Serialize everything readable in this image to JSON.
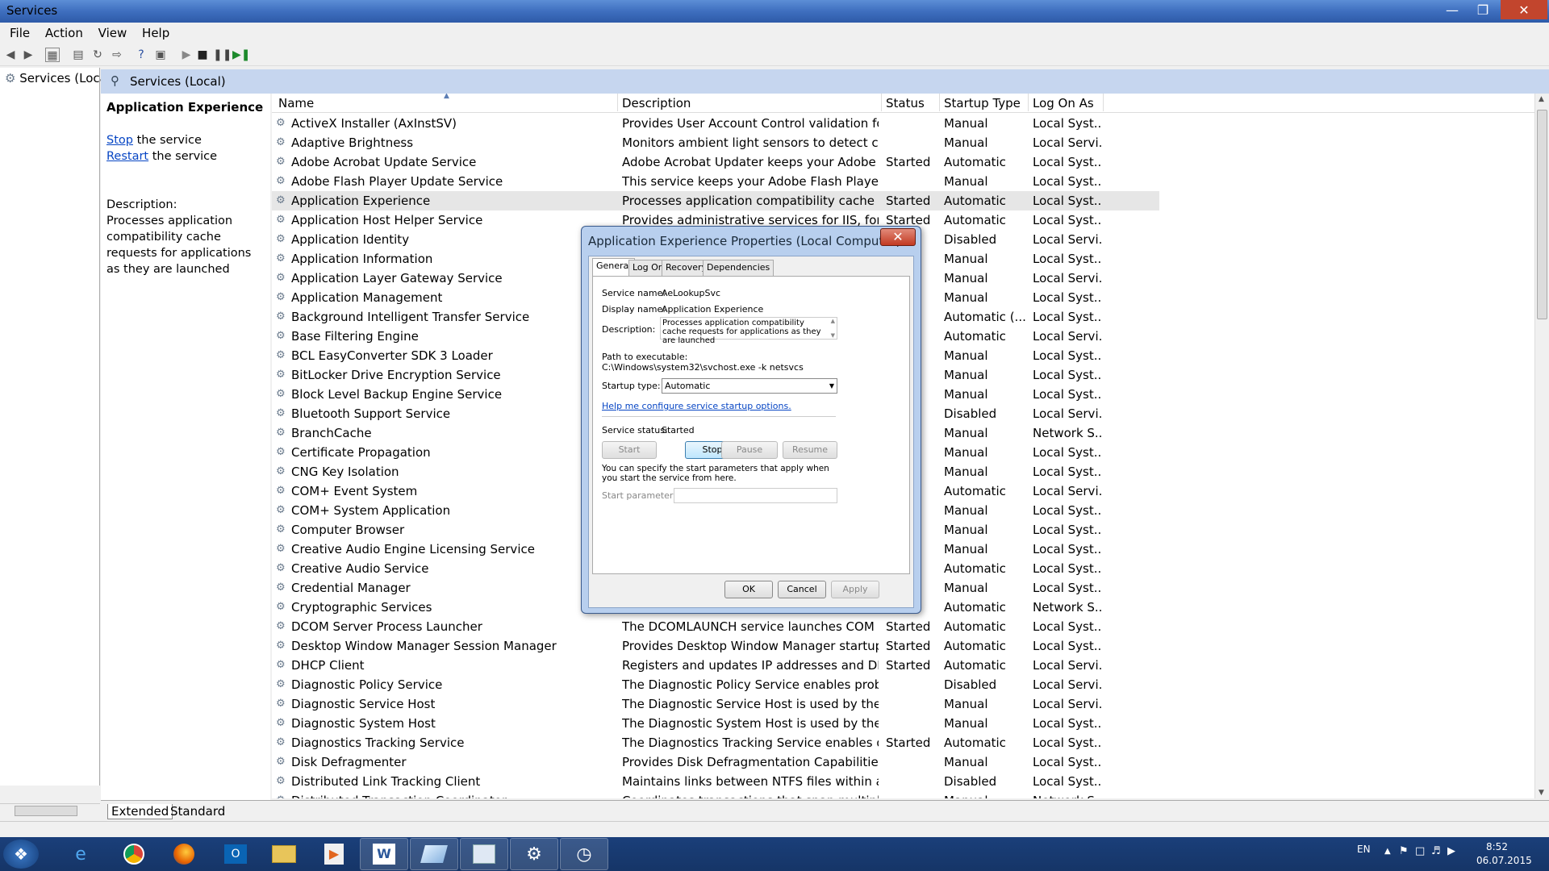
{
  "window": {
    "title": "Services"
  },
  "menu": [
    "File",
    "Action",
    "View",
    "Help"
  ],
  "tree": {
    "item": "Services (Loca"
  },
  "header": {
    "title": "Services (Local)"
  },
  "info": {
    "title": "Application Experience",
    "stop_link": "Stop",
    "stop_rest": " the service",
    "restart_link": "Restart",
    "restart_rest": " the service",
    "desc_label": "Description:",
    "desc_text": "Processes application compatibility cache requests for applications as they are launched"
  },
  "columns": [
    "Name",
    "Description",
    "Status",
    "Startup Type",
    "Log On As"
  ],
  "services": [
    [
      "ActiveX Installer (AxInstSV)",
      "Provides User Account Control validation for t...",
      "",
      "Manual",
      "Local Syst..."
    ],
    [
      "Adaptive Brightness",
      "Monitors ambient light sensors to detect chan...",
      "",
      "Manual",
      "Local Servi..."
    ],
    [
      "Adobe Acrobat Update Service",
      "Adobe Acrobat Updater keeps your Adobe so...",
      "Started",
      "Automatic",
      "Local Syst..."
    ],
    [
      "Adobe Flash Player Update Service",
      "This service keeps your Adobe Flash Player ins...",
      "",
      "Manual",
      "Local Syst..."
    ],
    [
      "Application Experience",
      "Processes application compatibility cache req...",
      "Started",
      "Automatic",
      "Local Syst..."
    ],
    [
      "Application Host Helper Service",
      "Provides administrative services for IIS, for exa...",
      "Started",
      "Automatic",
      "Local Syst..."
    ],
    [
      "Application Identity",
      "",
      "",
      "Disabled",
      "Local Servi..."
    ],
    [
      "Application Information",
      "",
      "",
      "Manual",
      "Local Syst..."
    ],
    [
      "Application Layer Gateway Service",
      "",
      "",
      "Manual",
      "Local Servi..."
    ],
    [
      "Application Management",
      "",
      "",
      "Manual",
      "Local Syst..."
    ],
    [
      "Background Intelligent Transfer Service",
      "",
      "",
      "Automatic (...",
      "Local Syst..."
    ],
    [
      "Base Filtering Engine",
      "",
      "",
      "Automatic",
      "Local Servi..."
    ],
    [
      "BCL EasyConverter SDK 3 Loader",
      "",
      "",
      "Manual",
      "Local Syst..."
    ],
    [
      "BitLocker Drive Encryption Service",
      "",
      "",
      "Manual",
      "Local Syst..."
    ],
    [
      "Block Level Backup Engine Service",
      "",
      "",
      "Manual",
      "Local Syst..."
    ],
    [
      "Bluetooth Support Service",
      "",
      "",
      "Disabled",
      "Local Servi..."
    ],
    [
      "BranchCache",
      "",
      "",
      "Manual",
      "Network S..."
    ],
    [
      "Certificate Propagation",
      "",
      "",
      "Manual",
      "Local Syst..."
    ],
    [
      "CNG Key Isolation",
      "",
      "",
      "Manual",
      "Local Syst..."
    ],
    [
      "COM+ Event System",
      "",
      "",
      "Automatic",
      "Local Servi..."
    ],
    [
      "COM+ System Application",
      "",
      "",
      "Manual",
      "Local Syst..."
    ],
    [
      "Computer Browser",
      "",
      "",
      "Manual",
      "Local Syst..."
    ],
    [
      "Creative Audio Engine Licensing Service",
      "",
      "",
      "Manual",
      "Local Syst..."
    ],
    [
      "Creative Audio Service",
      "",
      "",
      "Automatic",
      "Local Syst..."
    ],
    [
      "Credential Manager",
      "",
      "",
      "Manual",
      "Local Syst..."
    ],
    [
      "Cryptographic Services",
      "",
      "",
      "Automatic",
      "Network S..."
    ],
    [
      "DCOM Server Process Launcher",
      "The DCOMLAUNCH service launches COM and...",
      "Started",
      "Automatic",
      "Local Syst..."
    ],
    [
      "Desktop Window Manager Session Manager",
      "Provides Desktop Window Manager startup a...",
      "Started",
      "Automatic",
      "Local Syst..."
    ],
    [
      "DHCP Client",
      "Registers and updates IP addresses and DNS r...",
      "Started",
      "Automatic",
      "Local Servi..."
    ],
    [
      "Diagnostic Policy Service",
      "The Diagnostic Policy Service enables proble...",
      "",
      "Disabled",
      "Local Servi..."
    ],
    [
      "Diagnostic Service Host",
      "The Diagnostic Service Host is used by the Dia...",
      "",
      "Manual",
      "Local Servi..."
    ],
    [
      "Diagnostic System Host",
      "The Diagnostic System Host is used by the Dia...",
      "",
      "Manual",
      "Local Syst..."
    ],
    [
      "Diagnostics Tracking Service",
      "The Diagnostics Tracking Service enables data...",
      "Started",
      "Automatic",
      "Local Syst..."
    ],
    [
      "Disk Defragmenter",
      "Provides Disk Defragmentation Capabilities.",
      "",
      "Manual",
      "Local Syst..."
    ],
    [
      "Distributed Link Tracking Client",
      "Maintains links between NTFS files within a co...",
      "",
      "Disabled",
      "Local Syst..."
    ],
    [
      "Distributed Transaction Coordinator",
      "Coordinates transactions that span multiple re...",
      "",
      "Manual",
      "Network S..."
    ]
  ],
  "tabs": [
    "Extended",
    "Standard"
  ],
  "dialog": {
    "title": "Application Experience Properties (Local Computer)",
    "tabs": [
      "General",
      "Log On",
      "Recovery",
      "Dependencies"
    ],
    "service_name_label": "Service name:",
    "service_name": "AeLookupSvc",
    "display_name_label": "Display name:",
    "display_name": "Application Experience",
    "description_label": "Description:",
    "description": "Processes application compatibility cache requests for applications as they are launched",
    "path_label": "Path to executable:",
    "path": "C:\\Windows\\system32\\svchost.exe -k netsvcs",
    "startup_label": "Startup type:",
    "startup_value": "Automatic",
    "help_link": "Help me configure service startup options.",
    "status_label": "Service status:",
    "status_value": "Started",
    "buttons": {
      "start": "Start",
      "stop": "Stop",
      "pause": "Pause",
      "resume": "Resume"
    },
    "params_note": "You can specify the start parameters that apply when you start the service from here.",
    "params_label": "Start parameters:",
    "ok": "OK",
    "cancel": "Cancel",
    "apply": "Apply"
  },
  "tray": {
    "lang": "EN",
    "time": "8:52",
    "date": "06.07.2015"
  }
}
